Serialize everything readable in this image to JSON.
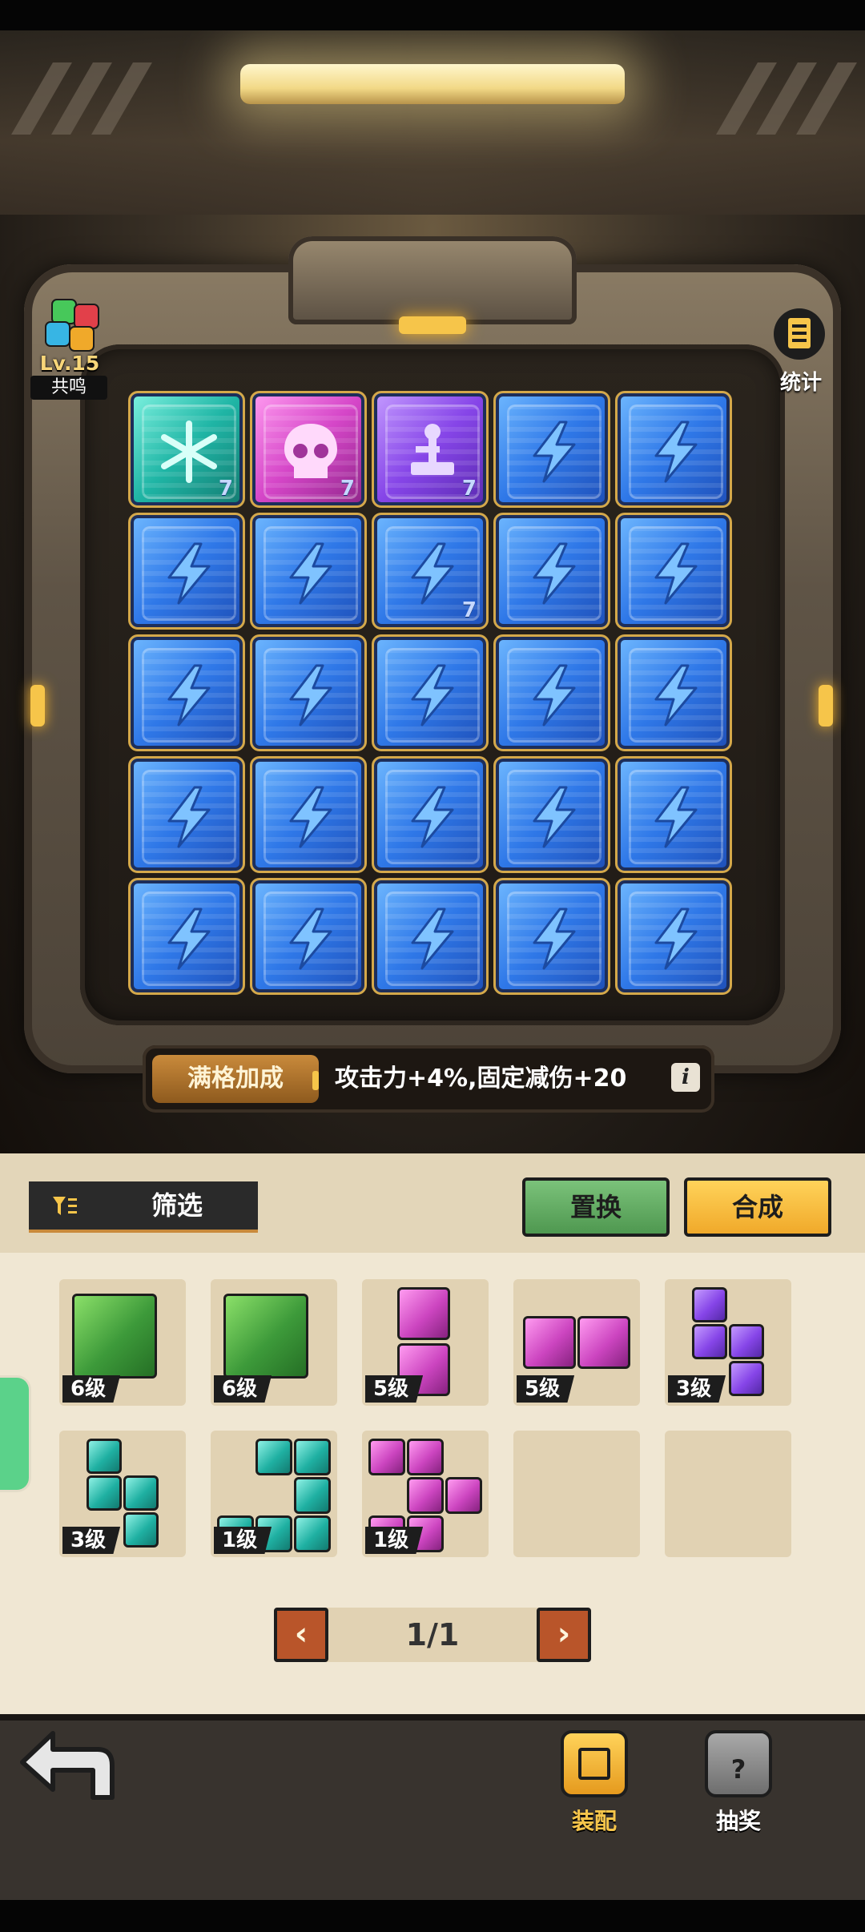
{
  "resonance": {
    "level": "Lv.15",
    "label": "共鸣"
  },
  "stats": {
    "label": "统计"
  },
  "grid": {
    "rows": 5,
    "cols": 5,
    "tiles": [
      {
        "type": "teal",
        "icon": "snowflake-icon",
        "level": "7"
      },
      {
        "type": "pink",
        "icon": "skull-icon",
        "level": "7"
      },
      {
        "type": "purple",
        "icon": "joystick-icon",
        "level": "7"
      },
      {
        "type": "blue",
        "icon": "lightning-icon",
        "level": ""
      },
      {
        "type": "blue",
        "icon": "lightning-icon",
        "level": ""
      },
      {
        "type": "blue",
        "icon": "lightning-icon",
        "level": ""
      },
      {
        "type": "blue",
        "icon": "lightning-icon",
        "level": ""
      },
      {
        "type": "blue",
        "icon": "lightning-icon",
        "level": "7"
      },
      {
        "type": "blue",
        "icon": "lightning-icon",
        "level": ""
      },
      {
        "type": "blue",
        "icon": "lightning-icon",
        "level": ""
      },
      {
        "type": "blue",
        "icon": "lightning-icon",
        "level": ""
      },
      {
        "type": "blue",
        "icon": "lightning-icon",
        "level": ""
      },
      {
        "type": "blue",
        "icon": "lightning-icon",
        "level": ""
      },
      {
        "type": "blue",
        "icon": "lightning-icon",
        "level": ""
      },
      {
        "type": "blue",
        "icon": "lightning-icon",
        "level": ""
      },
      {
        "type": "blue",
        "icon": "lightning-icon",
        "level": ""
      },
      {
        "type": "blue",
        "icon": "lightning-icon",
        "level": ""
      },
      {
        "type": "blue",
        "icon": "lightning-icon",
        "level": ""
      },
      {
        "type": "blue",
        "icon": "lightning-icon",
        "level": ""
      },
      {
        "type": "blue",
        "icon": "lightning-icon",
        "level": ""
      },
      {
        "type": "blue",
        "icon": "lightning-icon",
        "level": ""
      },
      {
        "type": "blue",
        "icon": "lightning-icon",
        "level": ""
      },
      {
        "type": "blue",
        "icon": "lightning-icon",
        "level": ""
      },
      {
        "type": "blue",
        "icon": "lightning-icon",
        "level": ""
      },
      {
        "type": "blue",
        "icon": "lightning-icon",
        "level": ""
      }
    ]
  },
  "bonus": {
    "tag": "满格加成",
    "text": "攻击力+4%,固定减伤+20",
    "info": "i"
  },
  "toolbar": {
    "filter_label": "筛选",
    "replace_label": "置换",
    "compose_label": "合成"
  },
  "inventory": [
    {
      "color": "g",
      "shape": "single-green",
      "level": "6级"
    },
    {
      "color": "g",
      "shape": "single-green",
      "level": "6级"
    },
    {
      "color": "p",
      "shape": "vertical-pink",
      "level": "5级"
    },
    {
      "color": "p",
      "shape": "horizontal-pink",
      "level": "5级"
    },
    {
      "color": "v",
      "shape": "stair-purple",
      "level": "3级"
    },
    {
      "color": "t",
      "shape": "stair-teal",
      "level": "3级"
    },
    {
      "color": "t",
      "shape": "j-teal",
      "level": "1级"
    },
    {
      "color": "p",
      "shape": "z-pink",
      "level": "1级"
    },
    {
      "color": "",
      "shape": "empty",
      "level": ""
    },
    {
      "color": "",
      "shape": "empty",
      "level": ""
    }
  ],
  "pager": {
    "prev": "‹",
    "text": "1/1",
    "next": "›"
  },
  "nav": {
    "equip_label": "装配",
    "lottery_label": "抽奖"
  },
  "colors": {
    "accent_gold": "#f6c54a",
    "panel_bg": "#f0e7d3",
    "replace_green": "#4f9850",
    "compose_yellow": "#f0a92a"
  }
}
